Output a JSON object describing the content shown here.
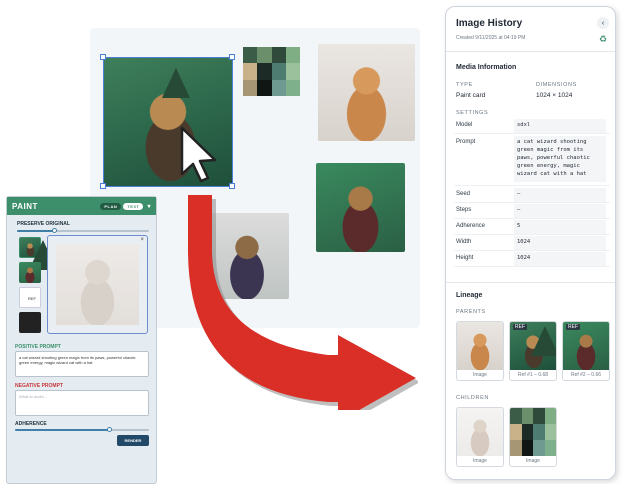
{
  "history": {
    "title": "Image History",
    "created": "Created 9/11/2025 at 04:19 PM",
    "media_heading": "Media Information",
    "type_cap": "TYPE",
    "type_val": "Paint card",
    "dim_cap": "DIMENSIONS",
    "dim_val": "1024 × 1024",
    "settings_cap": "SETTINGS",
    "settings": [
      {
        "key": "Model",
        "value": "sdxl"
      },
      {
        "key": "Prompt",
        "value": "a cat wizard shooting green magic from its paws, powerful chaotic green energy, magic wizard cat with a hat"
      },
      {
        "key": "Seed",
        "value": "–"
      },
      {
        "key": "Steps",
        "value": "–"
      },
      {
        "key": "Adherence",
        "value": "5"
      },
      {
        "key": "Width",
        "value": "1024"
      },
      {
        "key": "Height",
        "value": "1024"
      }
    ],
    "lineage_heading": "Lineage",
    "parents_cap": "PARENTS",
    "parents": [
      {
        "label": "Image",
        "tag": ""
      },
      {
        "label": "Ref #1 – 0.68",
        "tag": "REF"
      },
      {
        "label": "Ref #2 – 0.66",
        "tag": "REF"
      }
    ],
    "children_cap": "CHILDREN",
    "children": [
      {
        "label": "Image"
      },
      {
        "label": "Image"
      }
    ],
    "back_icon": "chevron-left-icon",
    "recycle_icon": "recycle-icon",
    "accent": "#3d8f6c"
  },
  "paint": {
    "title": "PAINT",
    "toggle": [
      "PLAN",
      "TEXT"
    ],
    "preserve_label": "PRESERVE ORIGINAL",
    "ref_label": "REF",
    "positive_label": "POSITIVE PROMPT",
    "positive_value": "a cat wizard shooting green magic from its paws, powerful chaotic green energy, magic wizard cat with a hat",
    "negative_label": "NEGATIVE PROMPT",
    "negative_placeholder": "What to avoid...",
    "adherence_label": "ADHERENCE",
    "render_label": "RENDER",
    "preserve_level": 0.28,
    "adherence_level": 0.7
  },
  "colors": {
    "arrow": "#d92f27",
    "selection": "#4a7fd4",
    "palette": [
      "#3b5d47",
      "#6a8f6a",
      "#2f4a3b",
      "#7fae84",
      "#c9b28a",
      "#1c2b26",
      "#4f7c70",
      "#9ac19b",
      "#a79673",
      "#101614",
      "#6e9a92",
      "#7fb08c"
    ]
  }
}
